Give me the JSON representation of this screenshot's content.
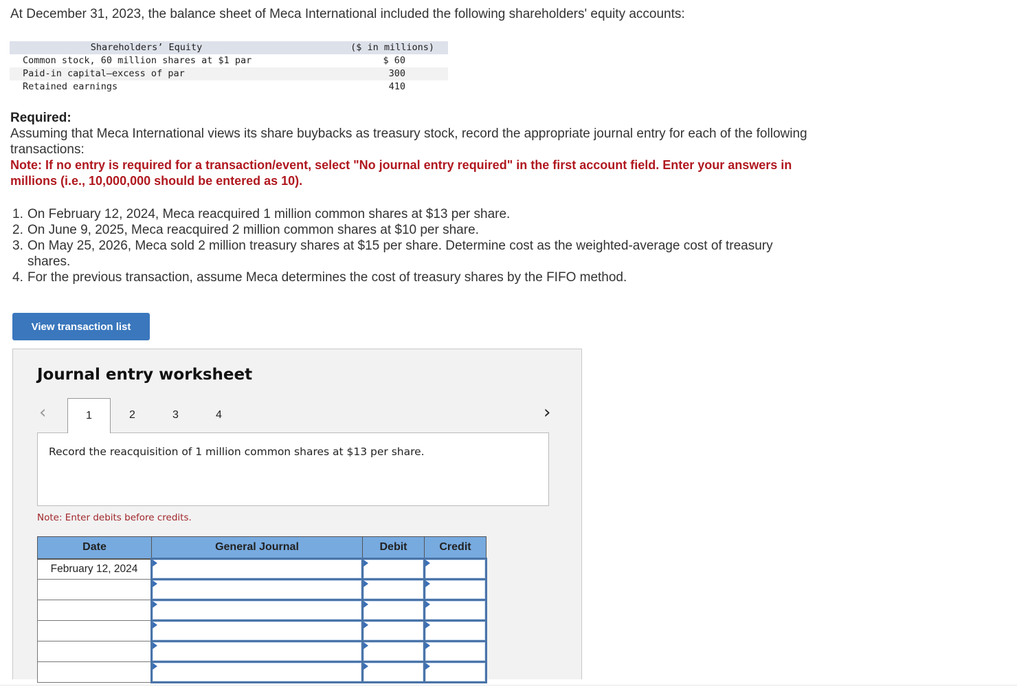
{
  "intro": "At December 31, 2023, the balance sheet of Meca International included the following shareholders' equity accounts:",
  "equity_table": {
    "header_label": "Shareholders’ Equity",
    "header_value": "($ in millions)",
    "rows": [
      {
        "label": "Common stock, 60 million shares at $1 par",
        "value": "$ 60"
      },
      {
        "label": "Paid-in capital—excess of par",
        "value": "300"
      },
      {
        "label": "Retained earnings",
        "value": "410"
      }
    ]
  },
  "required": {
    "title": "Required:",
    "text": "Assuming that Meca International views its share buybacks as treasury stock, record the appropriate journal entry for each of the following transactions:",
    "note": "Note: If no entry is required for a transaction/event, select \"No journal entry required\" in the first account field. Enter your answers in millions (i.e., 10,000,000 should be entered as 10)."
  },
  "transactions": [
    {
      "num": "1.",
      "text": "On February 12, 2024, Meca reacquired 1 million common shares at $13 per share."
    },
    {
      "num": "2.",
      "text": "On June 9, 2025, Meca reacquired 2 million common shares at $10 per share."
    },
    {
      "num": "3.",
      "text": "On May 25, 2026, Meca sold 2 million treasury shares at $15 per share. Determine cost as the weighted-average cost of treasury shares."
    },
    {
      "num": "4.",
      "text": "For the previous transaction, assume Meca determines the cost of treasury shares by the FIFO method."
    }
  ],
  "view_button_label": "View transaction list",
  "worksheet": {
    "title": "Journal entry worksheet",
    "prev_icon": "‹",
    "next_icon": "›",
    "tabs": [
      "1",
      "2",
      "3",
      "4"
    ],
    "active_tab": "1",
    "description": "Record the reacquisition of 1 million common shares at $13 per share.",
    "debit_note": "Note: Enter debits before credits.",
    "columns": {
      "date": "Date",
      "general_journal": "General Journal",
      "debit": "Debit",
      "credit": "Credit"
    },
    "rows": [
      {
        "date": "February 12, 2024",
        "account": "",
        "debit": "",
        "credit": ""
      },
      {
        "date": "",
        "account": "",
        "debit": "",
        "credit": ""
      },
      {
        "date": "",
        "account": "",
        "debit": "",
        "credit": ""
      },
      {
        "date": "",
        "account": "",
        "debit": "",
        "credit": ""
      },
      {
        "date": "",
        "account": "",
        "debit": "",
        "credit": ""
      },
      {
        "date": "",
        "account": "",
        "debit": "",
        "credit": ""
      }
    ]
  }
}
